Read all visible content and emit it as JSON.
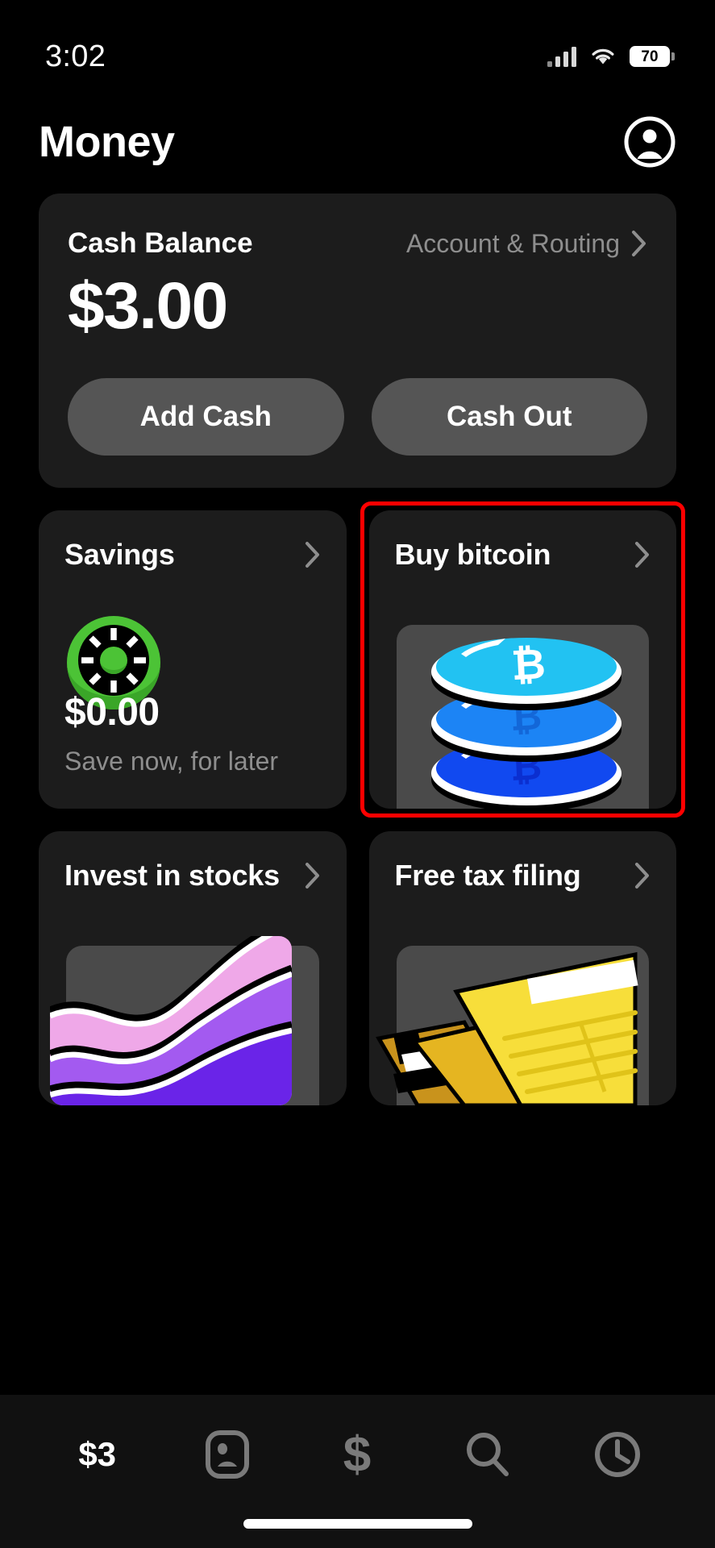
{
  "status_bar": {
    "time": "3:02",
    "signal_icon": "cellular-signal-icon",
    "wifi_icon": "wifi-icon",
    "battery_level": "70"
  },
  "header": {
    "title": "Money",
    "profile_icon": "account-circle-icon"
  },
  "balance_card": {
    "label": "Cash Balance",
    "account_routing_label": "Account & Routing",
    "chevron_icon": "chevron-right-icon",
    "amount": "$3.00",
    "add_cash_label": "Add Cash",
    "cash_out_label": "Cash Out"
  },
  "tiles": [
    {
      "id": "savings",
      "title": "Savings",
      "chevron_icon": "chevron-right-icon",
      "art_icon": "vault-dial-icon",
      "amount": "$0.00",
      "subtitle": "Save now, for later",
      "accent": "#4CC336"
    },
    {
      "id": "buy-bitcoin",
      "title": "Buy bitcoin",
      "chevron_icon": "chevron-right-icon",
      "art_icon": "bitcoin-coin-stack-icon",
      "highlighted": true,
      "highlight_color": "#ff0000",
      "accent": "#22C2F2"
    },
    {
      "id": "invest-in-stocks",
      "title": "Invest in stocks",
      "chevron_icon": "chevron-right-icon",
      "art_icon": "stock-waves-icon",
      "accent": "#7B3FF2"
    },
    {
      "id": "free-tax-filing",
      "title": "Free tax filing",
      "chevron_icon": "chevron-right-icon",
      "art_icon": "tax-document-icon",
      "accent": "#F7DE3A"
    }
  ],
  "tabbar": {
    "items": [
      {
        "id": "money",
        "label": "$3",
        "icon": "money-balance-tab",
        "active": true
      },
      {
        "id": "card",
        "label": "",
        "icon": "card-tab-icon",
        "active": false
      },
      {
        "id": "payments",
        "label": "",
        "icon": "dollar-sign-tab-icon",
        "active": false
      },
      {
        "id": "search",
        "label": "",
        "icon": "search-tab-icon",
        "active": false
      },
      {
        "id": "activity",
        "label": "",
        "icon": "clock-tab-icon",
        "active": false
      }
    ]
  },
  "colors": {
    "background": "#000000",
    "card": "#1c1c1c",
    "button": "#555555",
    "muted_text": "#8e8e8e",
    "highlight": "#ff0000"
  }
}
